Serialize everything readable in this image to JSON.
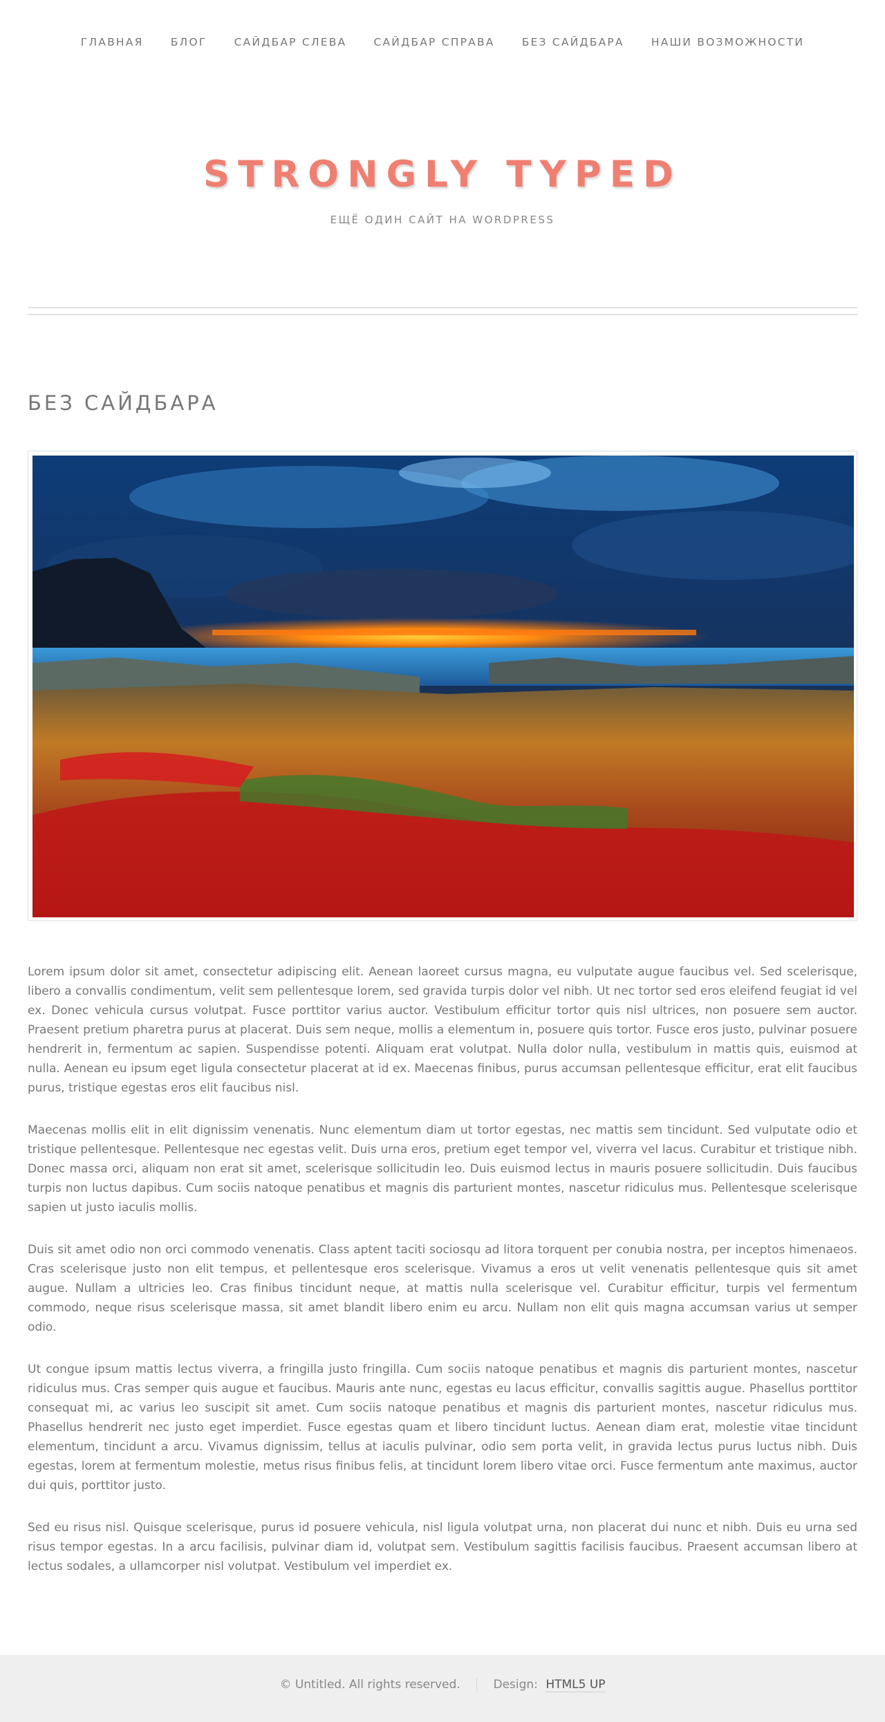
{
  "nav": {
    "items": [
      {
        "label": "ГЛАВНАЯ"
      },
      {
        "label": "БЛОГ"
      },
      {
        "label": "САЙДБАР СЛЕВА"
      },
      {
        "label": "САЙДБАР СПРАВА"
      },
      {
        "label": "БЕЗ САЙДБАРА"
      },
      {
        "label": "НАШИ ВОЗМОЖНОСТИ"
      }
    ]
  },
  "header": {
    "logo": "STRONGLY TYPED",
    "tagline": "ЕЩЁ ОДИН САЙТ НА WORDPRESS"
  },
  "main": {
    "title": "БЕЗ САЙДБАРА",
    "paragraphs": [
      "Lorem ipsum dolor sit amet, consectetur adipiscing elit. Aenean laoreet cursus magna, eu vulputate augue faucibus vel. Sed scelerisque, libero a convallis condimentum, velit sem pellentesque lorem, sed gravida turpis dolor vel nibh. Ut nec tortor sed eros eleifend feugiat id vel ex. Donec vehicula cursus volutpat. Fusce porttitor varius auctor. Vestibulum efficitur tortor quis nisl ultrices, non posuere sem auctor. Praesent pretium pharetra purus at placerat. Duis sem neque, mollis a elementum in, posuere quis tortor. Fusce eros justo, pulvinar posuere hendrerit in, fermentum ac sapien. Suspendisse potenti. Aliquam erat volutpat. Nulla dolor nulla, vestibulum in mattis quis, euismod at nulla. Aenean eu ipsum eget ligula consectetur placerat at id ex. Maecenas finibus, purus accumsan pellentesque efficitur, erat elit faucibus purus, tristique egestas eros elit faucibus nisl.",
      "Maecenas mollis elit in elit dignissim venenatis. Nunc elementum diam ut tortor egestas, nec mattis sem tincidunt. Sed vulputate odio et tristique pellentesque. Pellentesque nec egestas velit. Duis urna eros, pretium eget tempor vel, viverra vel lacus. Curabitur et tristique nibh. Donec massa orci, aliquam non erat sit amet, scelerisque sollicitudin leo. Duis euismod lectus in mauris posuere sollicitudin. Duis faucibus turpis non luctus dapibus. Cum sociis natoque penatibus et magnis dis parturient montes, nascetur ridiculus mus. Pellentesque scelerisque sapien ut justo iaculis mollis.",
      "Duis sit amet odio non orci commodo venenatis. Class aptent taciti sociosqu ad litora torquent per conubia nostra, per inceptos himenaeos. Cras scelerisque justo non elit tempus, et pellentesque eros scelerisque. Vivamus a eros ut velit venenatis pellentesque quis sit amet augue. Nullam a ultricies leo. Cras finibus tincidunt neque, at mattis nulla scelerisque vel. Curabitur efficitur, turpis vel fermentum commodo, neque risus scelerisque massa, sit amet blandit libero enim eu arcu. Nullam non elit quis magna accumsan varius ut semper odio.",
      "Ut congue ipsum mattis lectus viverra, a fringilla justo fringilla. Cum sociis natoque penatibus et magnis dis parturient montes, nascetur ridiculus mus. Cras semper quis augue et faucibus. Mauris ante nunc, egestas eu lacus efficitur, convallis sagittis augue. Phasellus porttitor consequat mi, ac varius leo suscipit sit amet. Cum sociis natoque penatibus et magnis dis parturient montes, nascetur ridiculus mus. Phasellus hendrerit nec justo eget imperdiet. Fusce egestas quam et libero tincidunt luctus. Aenean diam erat, molestie vitae tincidunt elementum, tincidunt a arcu. Vivamus dignissim, tellus at iaculis pulvinar, odio sem porta velit, in gravida lectus purus luctus nibh. Duis egestas, lorem at fermentum molestie, metus risus finibus felis, at tincidunt lorem libero vitae orci. Fusce fermentum ante maximus, auctor dui quis, porttitor justo.",
      "Sed eu risus nisl. Quisque scelerisque, purus id posuere vehicula, nisl ligula volutpat urna, non placerat dui nunc et nibh. Duis eu urna sed risus tempor egestas. In a arcu facilisis, pulvinar diam id, volutpat sem. Vestibulum sagittis facilisis faucibus. Praesent accumsan libero at lectus sodales, a ullamcorper nisl volutpat. Vestibulum vel imperdiet ex."
    ]
  },
  "footer": {
    "copyright": "© Untitled. All rights reserved.",
    "design_prefix": "Design:",
    "design_link": "HTML5 UP"
  },
  "colors": {
    "logo": "#ef7f71",
    "text": "#777777",
    "footer_bg": "#efefef"
  }
}
